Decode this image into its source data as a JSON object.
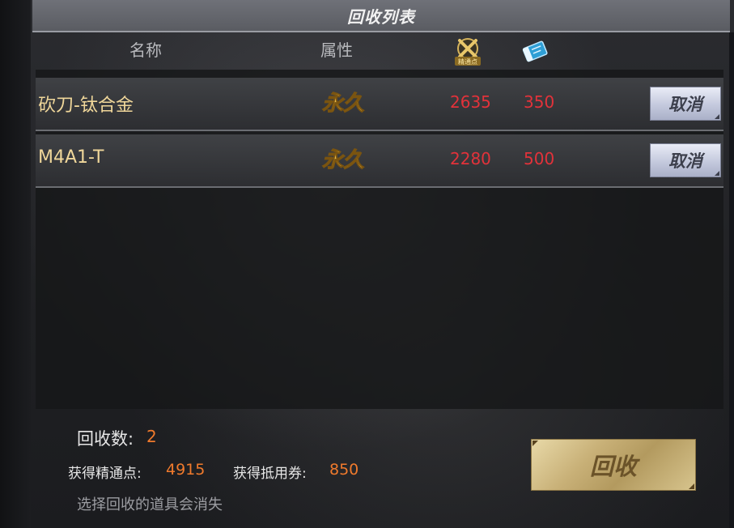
{
  "header": {
    "title": "回收列表",
    "columns": {
      "name": "名称",
      "attribute": "属性",
      "points_icon_label": "精通点"
    }
  },
  "items": [
    {
      "name": "砍刀-钛合金",
      "attribute": "永久",
      "points": "2635",
      "vouchers": "350",
      "cancel_label": "取消"
    },
    {
      "name": "M4A1-T",
      "attribute": "永久",
      "points": "2280",
      "vouchers": "500",
      "cancel_label": "取消"
    }
  ],
  "footer": {
    "count_label": "回收数:",
    "count_value": "2",
    "points_label": "获得精通点:",
    "points_value": "4915",
    "vouchers_label": "获得抵用券:",
    "vouchers_value": "850",
    "note": "选择回收的道具会消失",
    "recycle_label": "回收"
  },
  "colors": {
    "item_name": "#f0d79a",
    "value_red": "#e2323a",
    "value_orange": "#f07a2c",
    "recycle_gold": "#c8b077"
  },
  "icons": {
    "points": "mastery-points-icon",
    "voucher": "voucher-ticket-icon",
    "permanent": "permanent-badge-icon"
  }
}
